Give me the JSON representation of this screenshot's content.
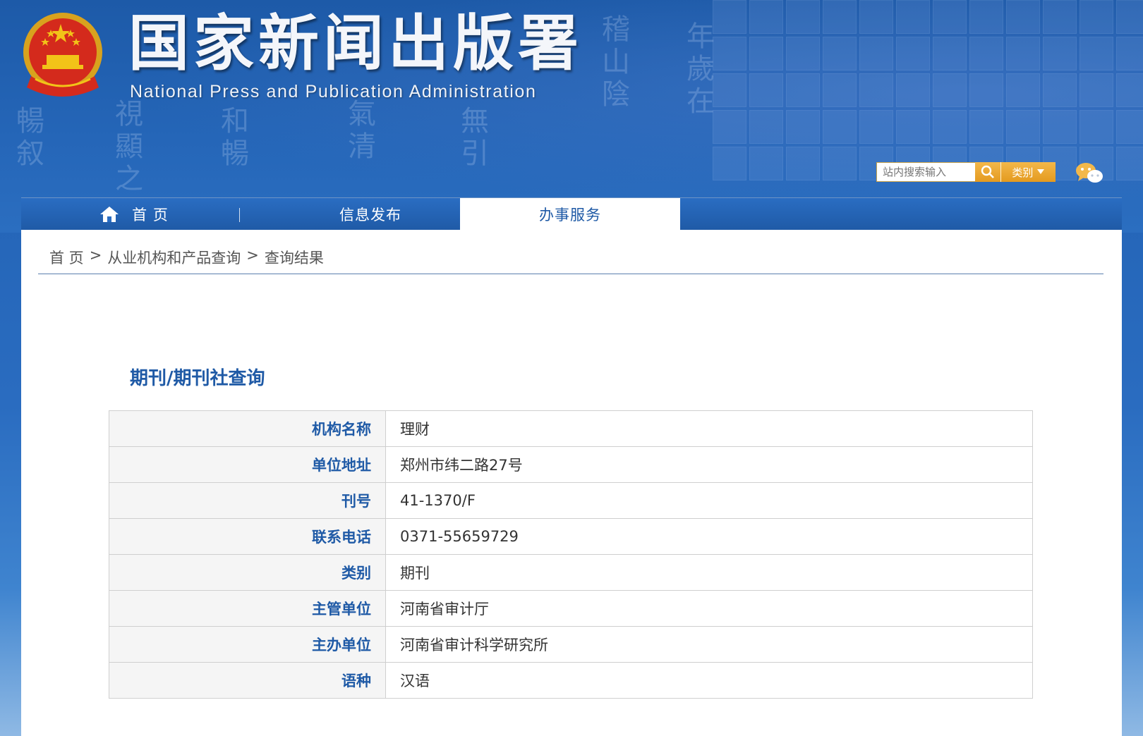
{
  "header": {
    "title_cn": "国家新闻出版署",
    "title_en": "National  Press and Publication Administration",
    "emblem_icon": "national-emblem-icon",
    "search": {
      "placeholder": "站内搜索输入",
      "search_icon": "search-icon",
      "category_label": "类别",
      "category_icon": "caret-down-icon"
    },
    "wechat_icon": "wechat-icon"
  },
  "nav": {
    "items": [
      {
        "label": "首 页",
        "icon": "home-icon"
      },
      {
        "label": "信息发布"
      },
      {
        "label": "办事服务",
        "active": true
      }
    ]
  },
  "breadcrumb": {
    "items": [
      "首 页",
      "从业机构和产品查询",
      "查询结果"
    ],
    "separator": ">"
  },
  "main": {
    "section_title": "期刊/期刊社查询",
    "rows": [
      {
        "label": "机构名称",
        "value": "理财"
      },
      {
        "label": "单位地址",
        "value": "郑州市纬二路27号"
      },
      {
        "label": "刊号",
        "value": "41-1370/F"
      },
      {
        "label": "联系电话",
        "value": "0371-55659729"
      },
      {
        "label": "类别",
        "value": "期刊"
      },
      {
        "label": "主管单位",
        "value": "河南省审计厅"
      },
      {
        "label": "主办单位",
        "value": "河南省审计科学研究所"
      },
      {
        "label": "语种",
        "value": "汉语"
      }
    ]
  },
  "colors": {
    "brand_blue": "#1f5aa6",
    "accent_orange": "#e49a1f"
  }
}
